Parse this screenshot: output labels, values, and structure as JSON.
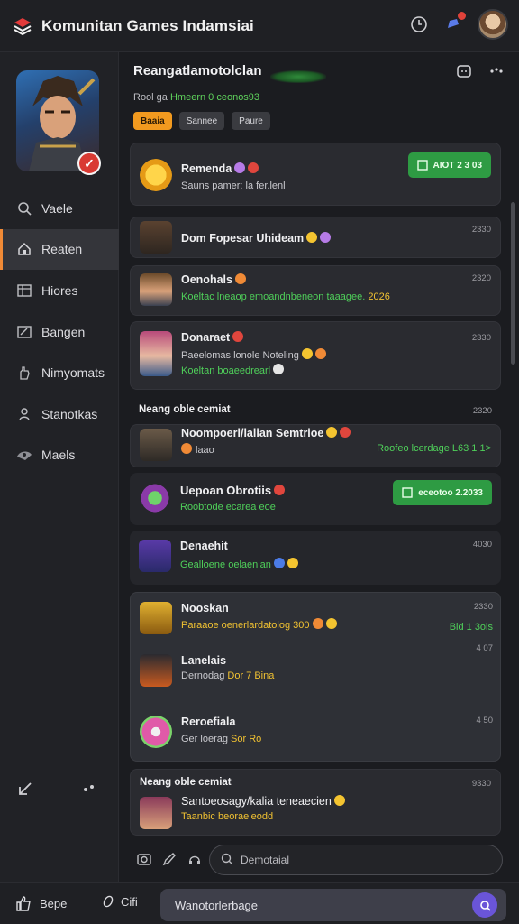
{
  "app": {
    "title": "Komunitan Games Indamsiai"
  },
  "sidebar": {
    "items": [
      {
        "label": "Vaele",
        "icon": "search-icon",
        "active": false
      },
      {
        "label": "Reaten",
        "icon": "home-icon",
        "active": true
      },
      {
        "label": "Hiores",
        "icon": "grid-icon",
        "active": false
      },
      {
        "label": "Bangen",
        "icon": "edit-icon",
        "active": false
      },
      {
        "label": "Nimyomats",
        "icon": "hand-icon",
        "active": false
      },
      {
        "label": "Stanotkas",
        "icon": "person-icon",
        "active": false
      },
      {
        "label": "Maels",
        "icon": "eye-icon",
        "active": false
      }
    ]
  },
  "group": {
    "title": "Reangatlamotolclan",
    "subtitle_prefix": "Rool ga",
    "subtitle_green": "Hmeern 0 ceonos93",
    "chips": [
      "Baaia",
      "Sannee",
      "Paure"
    ]
  },
  "messages": {
    "m1": {
      "name": "Remenda",
      "text": "Sauns pamer: la fer.lenl",
      "badge": "AIOT 2 3 03"
    },
    "m2": {
      "name": "Dom Fopesar Uhideam",
      "time": "2330"
    },
    "m3": {
      "name": "Oenohals",
      "text": "Koeltac lneaop emoandnbeneon taaagee.",
      "text_accent": "2026",
      "time": "2320"
    },
    "m4": {
      "name": "Donaraet",
      "text": "Paeelomas lonole Noteling",
      "text2": "Koeltan boaeedrearl",
      "time": "2330"
    },
    "section1": {
      "label": "Neang oble cemiat",
      "time": "2320"
    },
    "m5": {
      "name": "Noompoerl/lalian Semtrioe",
      "text": "laao",
      "text_right": "Roofeo lcerdage L63 1 1>"
    },
    "m6": {
      "name": "Uepoan Obrotiis",
      "text": "Roobtode ecarea eoe",
      "badge": "eceotoo 2.2033"
    },
    "m7": {
      "name": "Denaehit",
      "text": "Gealloene oelaenlan",
      "time": "4030"
    },
    "g1": {
      "name": "Nooskan",
      "text": "Paraaoe oenerlardatolog 300",
      "time": "2330",
      "right_tag": "Bld 1 3ols"
    },
    "g2": {
      "name": "Lanelais",
      "text": "Dernodag",
      "text_accent": "Dor 7 Bina",
      "time": "4 07"
    },
    "g3": {
      "name": "Reroefiala",
      "text": "Ger loerag",
      "text_accent": "Sor Ro",
      "time": "4 50"
    },
    "section2": {
      "label": "Neang oble cemiat",
      "time": "9330"
    },
    "m8": {
      "name": "Santoeosagy/kalia teneaecien",
      "text": "Taanbic beoraeleodd"
    }
  },
  "composer": {
    "placeholder": "Demotaial"
  },
  "bottom": {
    "like_label": "Bepe",
    "other_label": "Cifi",
    "input_text": "Wanotorlerbage"
  },
  "colors": {
    "accent_orange": "#f08a36",
    "green_badge": "#2e9b43",
    "chip_active": "#f29a1f",
    "send_button": "#6a55d8"
  }
}
